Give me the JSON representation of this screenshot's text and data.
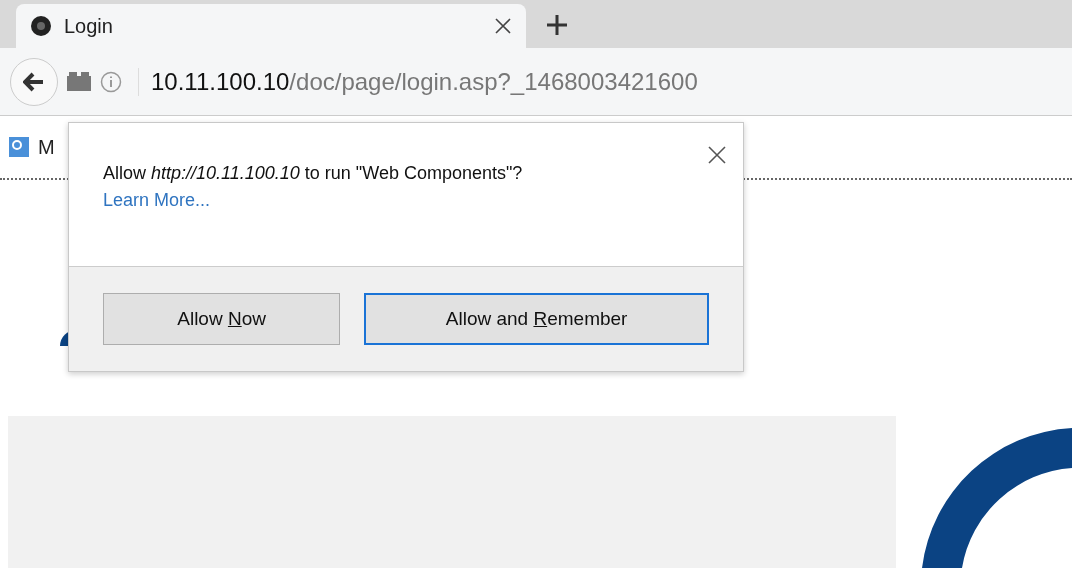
{
  "tabs": [
    {
      "title": "Login",
      "selected": true
    }
  ],
  "address_bar": {
    "host": "10.11.100.10",
    "path": "/doc/page/login.asp?_1468003421600"
  },
  "bookmarks": [
    {
      "label": "M"
    }
  ],
  "permission_popup": {
    "message": "Allow *http://10.11.100.10* to run \"Web Components\"?",
    "link": "Learn More...",
    "buttons": [
      {
        "before": "Allow ",
        "access_key": "N",
        "after": "ow",
        "default": false
      },
      {
        "before": "Allow and ",
        "access_key": "R",
        "after": "emember",
        "default": true
      }
    ]
  }
}
